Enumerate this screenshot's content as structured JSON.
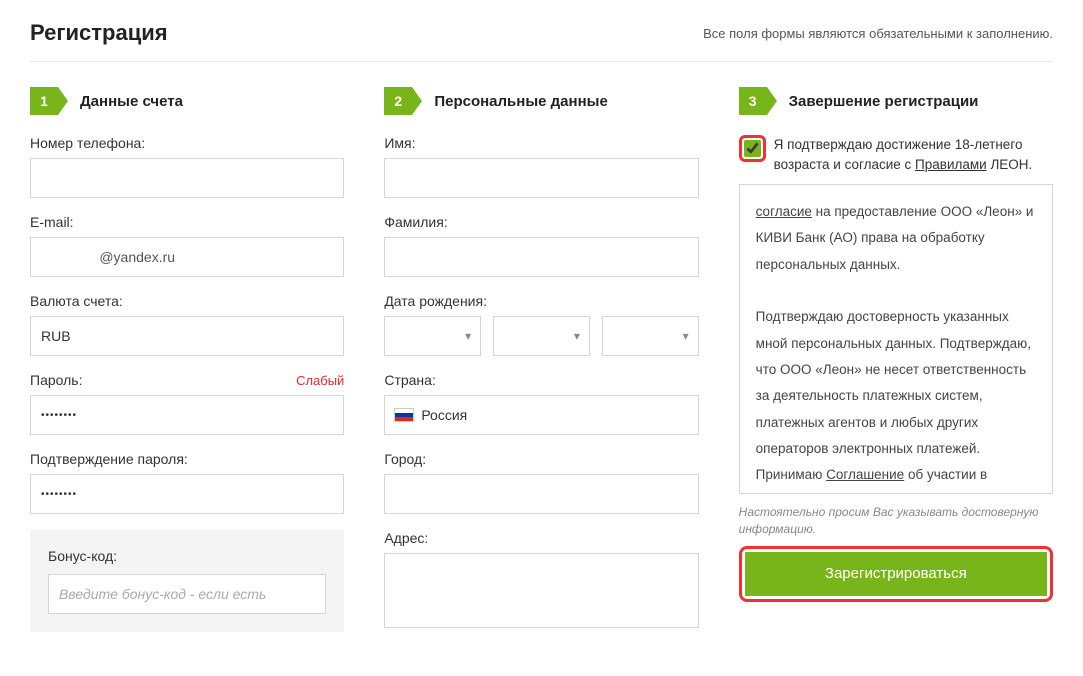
{
  "header": {
    "title": "Регистрация",
    "required_note": "Все поля формы являются обязательными к заполнению."
  },
  "steps": {
    "s1": {
      "num": "1",
      "title": "Данные счета"
    },
    "s2": {
      "num": "2",
      "title": "Персональные данные"
    },
    "s3": {
      "num": "3",
      "title": "Завершение регистрации"
    }
  },
  "col1": {
    "phone_label": "Номер телефона:",
    "phone_value": "",
    "email_label": "E-mail:",
    "email_value": "               @yandex.ru",
    "currency_label": "Валюта счета:",
    "currency_value": "RUB",
    "password_label": "Пароль:",
    "password_strength": "Слабый",
    "password_value": "••••••••",
    "password2_label": "Подтверждение пароля:",
    "password2_value": "••••••••",
    "bonus_label": "Бонус-код:",
    "bonus_placeholder": "Введите бонус-код - если есть"
  },
  "col2": {
    "firstname_label": "Имя:",
    "firstname_value": "  ",
    "lastname_label": "Фамилия:",
    "lastname_value": "  ",
    "dob_label": "Дата рождения:",
    "dob_day": " ",
    "dob_month": " ",
    "dob_year": " ",
    "country_label": "Страна:",
    "country_value": "Россия",
    "city_label": "Город:",
    "city_value": "  ",
    "address_label": "Адрес:",
    "address_value": "  "
  },
  "col3": {
    "agree_pre": "Я подтверждаю достижение 18-летнего возраста и согласие с ",
    "agree_rules": "Правилами",
    "agree_post": " ЛЕОН.",
    "terms_l1_a": "согласие",
    "terms_l1_b": " на предоставление ООО «Леон» и КИВИ Банк (АО) права на обработку персональных данных.",
    "terms_p2": "Подтверждаю достоверность указанных мной персональных данных. Подтверждаю, что ООО «Леон» не несет ответственность за деятельность платежных систем, платежных агентов и любых других операторов электронных платежей. Принимаю ",
    "terms_agreement": "Соглашение",
    "terms_p2_end": " об участии в азартной игре.",
    "disclaimer": "Настоятельно просим Вас указывать достоверную информацию.",
    "submit": "Зарегистрироваться"
  }
}
